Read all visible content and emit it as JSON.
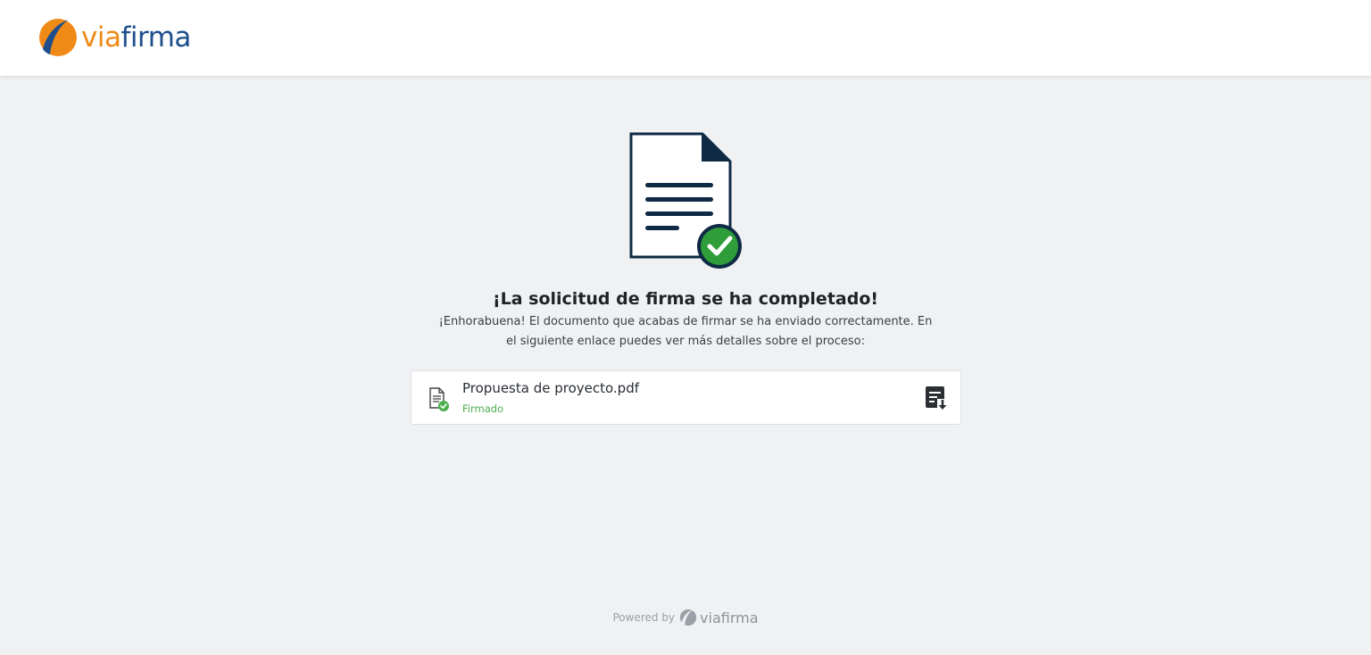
{
  "header": {
    "logo": {
      "part1": "via",
      "part2": "firma"
    }
  },
  "hero": {
    "icon": "document-check-icon"
  },
  "main": {
    "title": "¡La solicitud de firma se ha completado!",
    "message": "¡Enhorabuena! El documento que acabas de firmar se ha enviado correctamente. En el siguiente enlace puedes ver más detalles sobre el proceso:"
  },
  "document": {
    "name": "Propuesta de proyecto.pdf",
    "status": "Firmado",
    "status_color": "#4caf50",
    "download_icon": "download-icon"
  },
  "footer": {
    "powered_by": "Powered by",
    "brand": "viafirma"
  },
  "colors": {
    "brand_orange": "#ef8a17",
    "brand_blue": "#1d4f8c",
    "success_green": "#2e9d3a"
  }
}
